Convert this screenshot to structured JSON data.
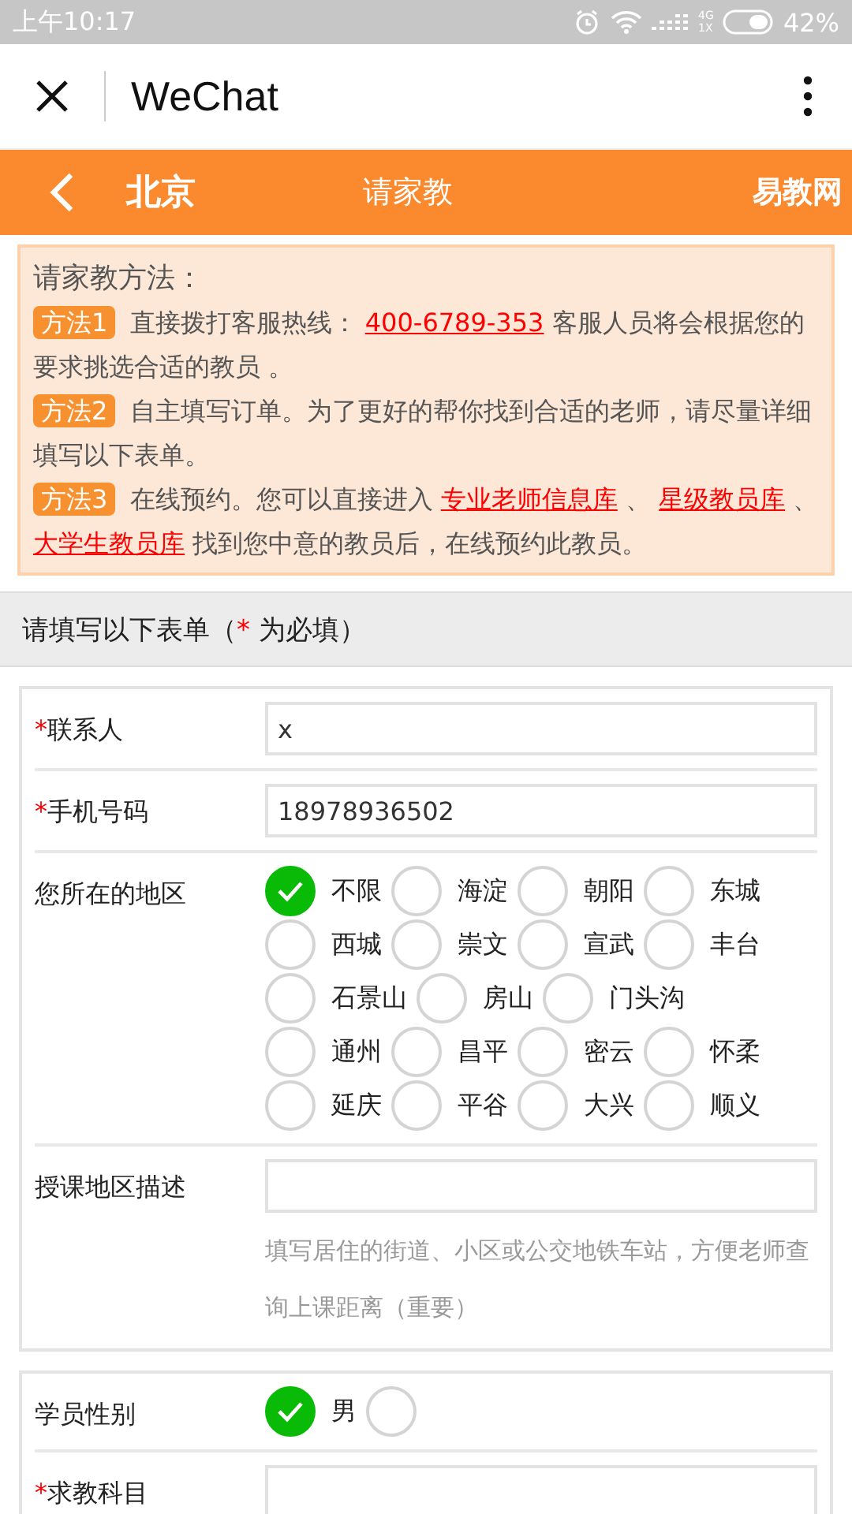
{
  "status_bar": {
    "time": "上午10:17",
    "network": [
      "4G",
      "1X"
    ],
    "battery": "42%"
  },
  "wechat_bar": {
    "title": "WeChat"
  },
  "header": {
    "city": "北京",
    "title": "请家教",
    "brand": "易教网"
  },
  "notice": {
    "heading": "请家教方法：",
    "methods": [
      {
        "badge": "方法1",
        "parts": [
          {
            "kind": "text",
            "text": "直接拨打客服热线： "
          },
          {
            "kind": "link",
            "text": "400-6789-353"
          },
          {
            "kind": "text",
            "text": " 客服人员将会根据您的要求挑选合适的教员 。"
          }
        ]
      },
      {
        "badge": "方法2",
        "parts": [
          {
            "kind": "text",
            "text": "自主填写订单。为了更好的帮你找到合适的老师，请尽量详细填写以下表单。"
          }
        ]
      },
      {
        "badge": "方法3",
        "parts": [
          {
            "kind": "text",
            "text": "在线预约。您可以直接进入 "
          },
          {
            "kind": "link",
            "text": "专业老师信息库"
          },
          {
            "kind": "text",
            "text": " 、 "
          },
          {
            "kind": "link",
            "text": "星级教员库"
          },
          {
            "kind": "text",
            "text": " 、 "
          },
          {
            "kind": "link",
            "text": "大学生教员库"
          },
          {
            "kind": "text",
            "text": " 找到您中意的教员后，在线预约此教员。"
          }
        ]
      }
    ]
  },
  "form_title": {
    "before": "请填写以下表单（",
    "star": "*",
    "after": " 为必填）"
  },
  "sections": [
    {
      "rows": [
        {
          "kind": "input",
          "label": "联系人",
          "required": true,
          "value": "x"
        },
        {
          "kind": "input",
          "label": "手机号码",
          "required": true,
          "value": "18978936502"
        },
        {
          "kind": "radios",
          "label": "您所在的地区",
          "required": false,
          "options": [
            {
              "label": "不限",
              "selected": true
            },
            {
              "label": "海淀",
              "selected": false
            },
            {
              "label": "朝阳",
              "selected": false
            },
            {
              "label": "东城",
              "selected": false
            },
            {
              "label": "西城",
              "selected": false
            },
            {
              "label": "崇文",
              "selected": false
            },
            {
              "label": "宣武",
              "selected": false
            },
            {
              "label": "丰台",
              "selected": false
            },
            {
              "label": "石景山",
              "selected": false
            },
            {
              "label": "房山",
              "selected": false
            },
            {
              "label": "门头沟",
              "selected": false
            },
            {
              "label": "通州",
              "selected": false
            },
            {
              "label": "昌平",
              "selected": false
            },
            {
              "label": "密云",
              "selected": false
            },
            {
              "label": "怀柔",
              "selected": false
            },
            {
              "label": "延庆",
              "selected": false
            },
            {
              "label": "平谷",
              "selected": false
            },
            {
              "label": "大兴",
              "selected": false
            },
            {
              "label": "顺义",
              "selected": false
            }
          ]
        },
        {
          "kind": "input",
          "label": "授课地区描述",
          "required": false,
          "hint": "填写居住的街道、小区或公交地铁车站，方便老师查询上课距离（重要）"
        }
      ]
    },
    {
      "rows": [
        {
          "kind": "radios",
          "label": "学员性别",
          "required": false,
          "options": [
            {
              "label": "男",
              "selected": true
            },
            {
              "selected": false
            }
          ]
        },
        {
          "kind": "input",
          "label": "求教科目",
          "required": true
        }
      ]
    }
  ]
}
